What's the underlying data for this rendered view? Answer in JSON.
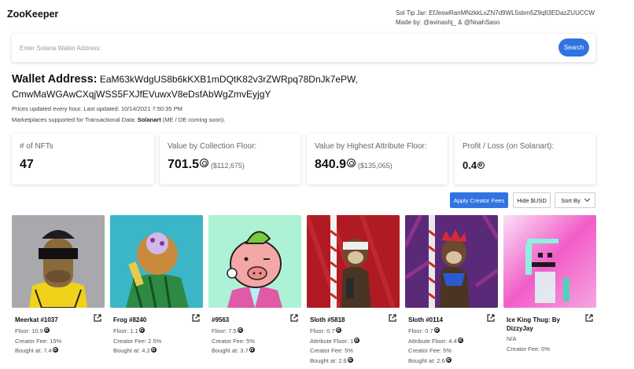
{
  "app": {
    "title": "ZooKeeper",
    "tip_jar": "Sol Tip Jar: EfJeswRanMNzkkLxZN7d9WL5sbm5Z9qfi3EDazZUUCCW",
    "made_by": "Made by: @avinashj_ & @NoahSaso"
  },
  "search": {
    "placeholder": "Enter Solana Wallet Address:",
    "button_label": "Search"
  },
  "wallet": {
    "label": "Wallet Address:",
    "address_line1": "EaM63kWdgUS8b6kKXB1mDQtK82v3rZWRpq78DnJk7ePW,",
    "address_line2": "CmwMaWGAwCXqjWSS5FXJfEVuwxV8eDsfAbWgZmvEyjgY",
    "prices_note": "Prices updated every hour. Last updated: 10/14/2021 7:50:35 PM",
    "marketplaces_prefix": "Marketplaces supported for Transactional Data:",
    "marketplaces_name": "Solanart",
    "marketplaces_suffix": "(ME / DE coming soon)."
  },
  "stats": [
    {
      "label": "# of NFTs",
      "value": "47",
      "usd": ""
    },
    {
      "label": "Value by Collection Floor:",
      "value": "701.5",
      "usd": "($112,675)"
    },
    {
      "label": "Value by Highest Attribute Floor:",
      "value": "840.9",
      "usd": "($135,065)"
    },
    {
      "label": "Profit / Loss (on Solanart):",
      "value": "0.4",
      "usd": ""
    }
  ],
  "controls": {
    "apply_creator_fees": "Apply Creator Fees",
    "hide_usd": "Hide $USD",
    "sort_by": "Sort By"
  },
  "cards": [
    {
      "name": "Meerkat #1037",
      "lines": [
        "Floor: 10.9",
        "Creator Fee: 15%",
        "Bought at: 7.4"
      ],
      "coin": [
        true,
        false,
        true
      ],
      "bg": "#a9a9ad"
    },
    {
      "name": "Frog #8240",
      "lines": [
        "Floor: 1.1",
        "Creator Fee: 2.5%",
        "Bought at: 4.2"
      ],
      "coin": [
        true,
        false,
        true
      ],
      "bg": "#3ab6c7"
    },
    {
      "name": "#9563",
      "lines": [
        "Floor: 7.5",
        "Creator Fee: 5%",
        "Bought at: 3.7"
      ],
      "coin": [
        true,
        false,
        true
      ],
      "bg": "#aef2d6"
    },
    {
      "name": "Sloth #5818",
      "lines": [
        "Floor: 0.7",
        "Attribute Floor: 1",
        "Creator Fee: 5%",
        "Bought at: 2.6"
      ],
      "coin": [
        true,
        true,
        false,
        true
      ],
      "bg": "#b01a22"
    },
    {
      "name": "Sloth #0114",
      "lines": [
        "Floor: 0.7",
        "Attribute Floor: 4.4",
        "Creator Fee: 5%",
        "Bought at: 2.6"
      ],
      "coin": [
        true,
        true,
        false,
        true
      ],
      "bg": "#5a2a78"
    },
    {
      "name": "Ice King Thug: By DizzyJay",
      "lines": [
        "N/A",
        "Creator Fee: 0%"
      ],
      "coin": [
        false,
        false
      ],
      "bg": "#f26ad0"
    }
  ],
  "icons": {
    "external_link": "external-link-icon",
    "sol_coin": "sol-coin-icon",
    "sort_chevron": "chevron-down-icon"
  },
  "colors": {
    "accent": "#2f74e0"
  }
}
